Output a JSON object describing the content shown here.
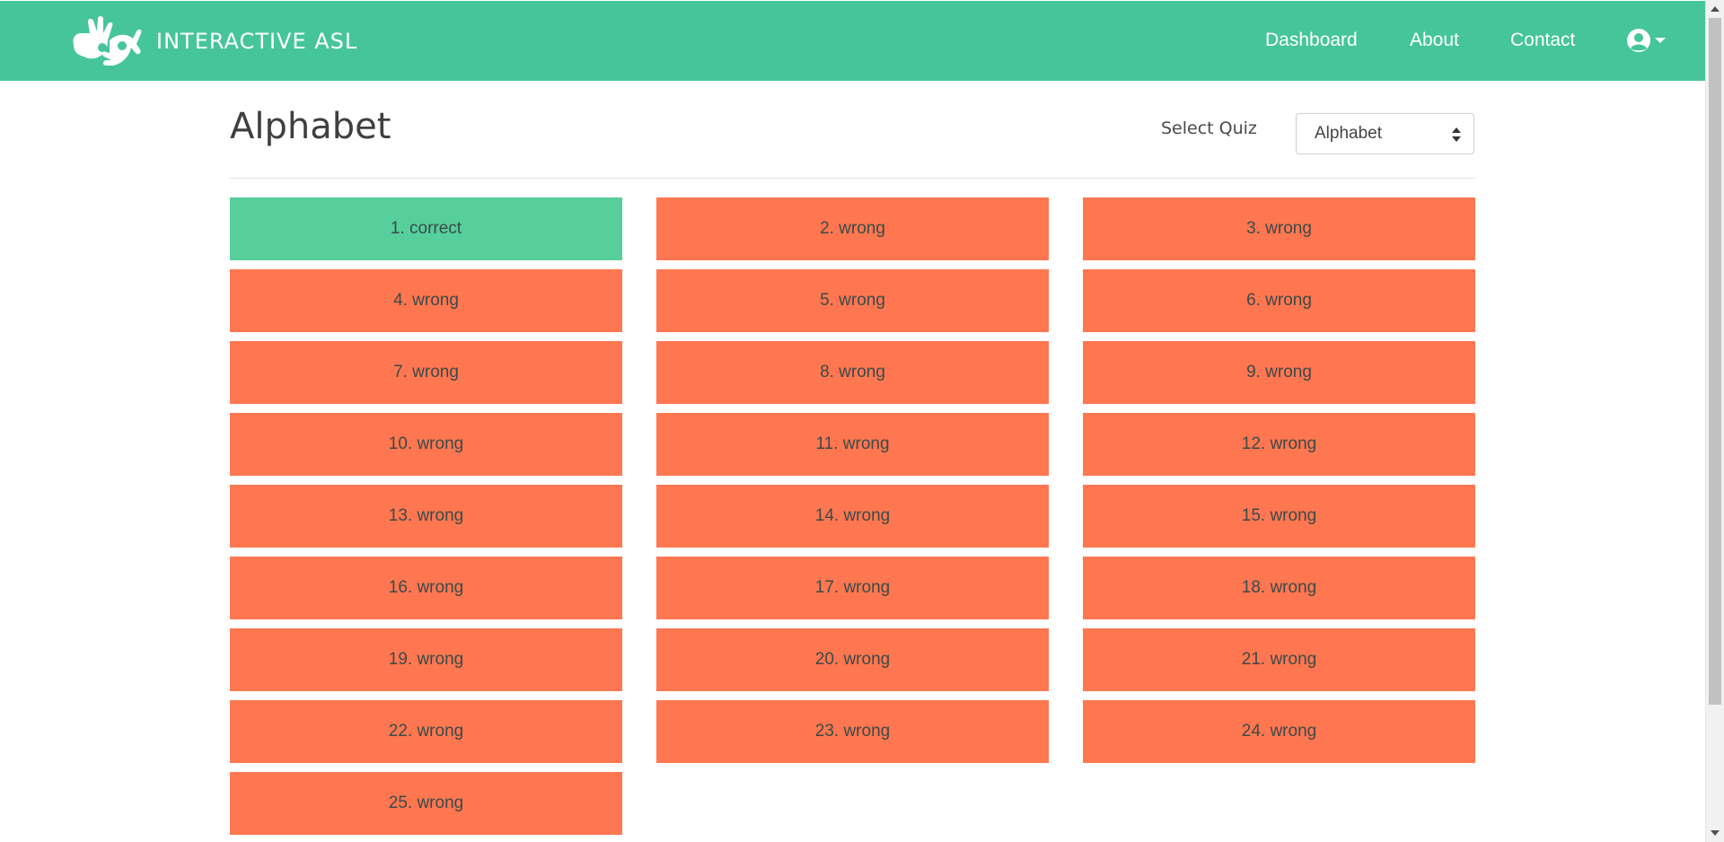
{
  "colors": {
    "navbar": "#46c59a",
    "correct": "#56cf9b",
    "wrong": "#ff7750",
    "divider": "#e5e5e5"
  },
  "navbar": {
    "brand": "INTERACTIVE ASL",
    "links": {
      "dashboard": "Dashboard",
      "about": "About",
      "contact": "Contact"
    },
    "user_icon": "user-circle-icon"
  },
  "main": {
    "title": "Alphabet",
    "select_label": "Select Quiz",
    "select_value": "Alphabet"
  },
  "results": [
    {
      "label": "1. correct",
      "status": "correct"
    },
    {
      "label": "2. wrong",
      "status": "wrong"
    },
    {
      "label": "3. wrong",
      "status": "wrong"
    },
    {
      "label": "4. wrong",
      "status": "wrong"
    },
    {
      "label": "5. wrong",
      "status": "wrong"
    },
    {
      "label": "6. wrong",
      "status": "wrong"
    },
    {
      "label": "7. wrong",
      "status": "wrong"
    },
    {
      "label": "8. wrong",
      "status": "wrong"
    },
    {
      "label": "9. wrong",
      "status": "wrong"
    },
    {
      "label": "10. wrong",
      "status": "wrong"
    },
    {
      "label": "11. wrong",
      "status": "wrong"
    },
    {
      "label": "12. wrong",
      "status": "wrong"
    },
    {
      "label": "13. wrong",
      "status": "wrong"
    },
    {
      "label": "14. wrong",
      "status": "wrong"
    },
    {
      "label": "15. wrong",
      "status": "wrong"
    },
    {
      "label": "16. wrong",
      "status": "wrong"
    },
    {
      "label": "17. wrong",
      "status": "wrong"
    },
    {
      "label": "18. wrong",
      "status": "wrong"
    },
    {
      "label": "19. wrong",
      "status": "wrong"
    },
    {
      "label": "20. wrong",
      "status": "wrong"
    },
    {
      "label": "21. wrong",
      "status": "wrong"
    },
    {
      "label": "22. wrong",
      "status": "wrong"
    },
    {
      "label": "23. wrong",
      "status": "wrong"
    },
    {
      "label": "24. wrong",
      "status": "wrong"
    },
    {
      "label": "25. wrong",
      "status": "wrong"
    }
  ]
}
